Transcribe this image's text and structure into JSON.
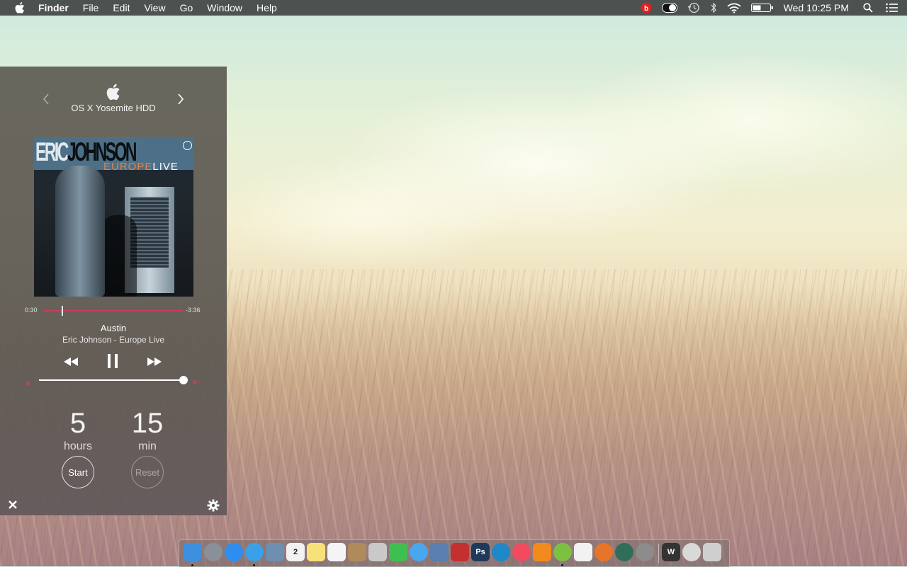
{
  "menubar": {
    "app_name": "Finder",
    "items": [
      "File",
      "Edit",
      "View",
      "Go",
      "Window",
      "Help"
    ],
    "clock": "Wed 10:25 PM",
    "status_icons": [
      "beats-icon",
      "toggle-icon",
      "time-machine-icon",
      "bluetooth-icon",
      "wifi-icon",
      "battery-icon",
      "spotlight-icon",
      "notification-center-icon"
    ]
  },
  "widget": {
    "device_name": "OS X Yosemite HDD",
    "album_art": {
      "artist_text": "ERIC",
      "artist_text2": "JOHNSON",
      "title_text": "EUROPE",
      "title_text2": "LIVE"
    },
    "playback": {
      "elapsed": "0:30",
      "remaining": "-3:36",
      "progress_fraction": 0.13
    },
    "track": {
      "title": "Austin",
      "subtitle": "Eric Johnson - Europe Live"
    },
    "volume_fraction": 1.0,
    "sleep_timer": {
      "hours_value": "5",
      "hours_label": "hours",
      "minutes_value": "15",
      "minutes_label": "min",
      "start_label": "Start",
      "reset_label": "Reset"
    }
  },
  "dock": {
    "apps": [
      {
        "name": "finder",
        "color": "#3d8fe0",
        "running": true
      },
      {
        "name": "launchpad",
        "color": "#8a9099",
        "running": false
      },
      {
        "name": "app-store",
        "color": "#2d8ef0",
        "running": false
      },
      {
        "name": "safari",
        "color": "#3aa0e8",
        "running": true
      },
      {
        "name": "preview",
        "color": "#6d8fb0",
        "running": false
      },
      {
        "name": "calendar",
        "color": "#f2f2f2",
        "running": false,
        "text": "2"
      },
      {
        "name": "notes",
        "color": "#f7e27a",
        "running": false
      },
      {
        "name": "reminders",
        "color": "#f4f4f4",
        "running": false
      },
      {
        "name": "contacts",
        "color": "#b08a5a",
        "running": false
      },
      {
        "name": "photo-booth",
        "color": "#c9c9c9",
        "running": false
      },
      {
        "name": "facetime",
        "color": "#3fbf4f",
        "running": false
      },
      {
        "name": "messages",
        "color": "#4aa6ef",
        "running": false
      },
      {
        "name": "iphoto",
        "color": "#5a7fb0",
        "running": false
      },
      {
        "name": "photo-booth-red",
        "color": "#c23030",
        "running": false
      },
      {
        "name": "photoshop",
        "color": "#1f3a5c",
        "running": false,
        "text": "Ps"
      },
      {
        "name": "mirror-app",
        "color": "#1e88c8",
        "running": false
      },
      {
        "name": "itunes",
        "color": "#f24a5e",
        "running": false
      },
      {
        "name": "ibooks",
        "color": "#f28a1e",
        "running": false
      },
      {
        "name": "spotify",
        "color": "#7cc142",
        "running": true
      },
      {
        "name": "vlc-app",
        "color": "#f2f2f2",
        "running": false
      },
      {
        "name": "firefox",
        "color": "#e8742a",
        "running": false
      },
      {
        "name": "time-machine",
        "color": "#2f6e5a",
        "running": false
      },
      {
        "name": "system-preferences",
        "color": "#8c8c8c",
        "running": false
      },
      {
        "name": "wwe-app",
        "color": "#333333",
        "running": false,
        "text": "W"
      },
      {
        "name": "downloads",
        "color": "#d9d9d9",
        "running": false
      },
      {
        "name": "trash",
        "color": "#cfcfcf",
        "running": false
      }
    ]
  }
}
